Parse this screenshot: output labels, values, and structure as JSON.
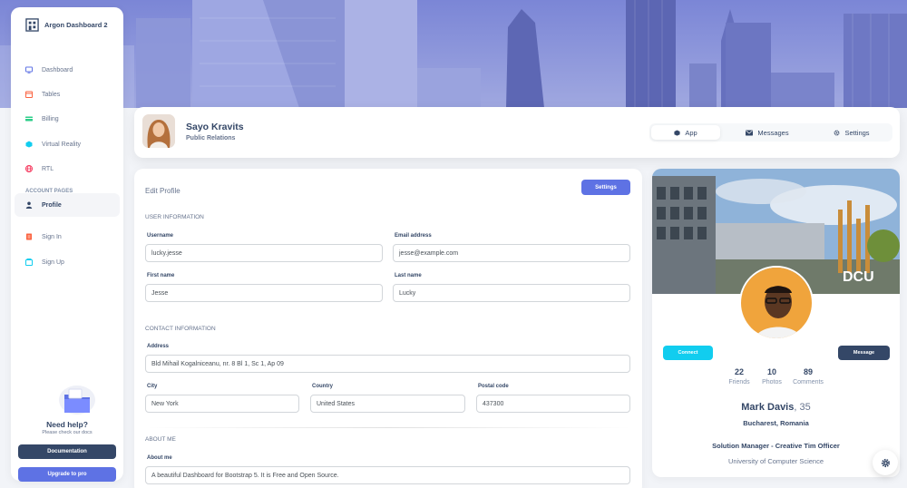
{
  "brand": {
    "name": "Argon Dashboard 2",
    "logo_icon": "buildings-logo-icon"
  },
  "sidebar": {
    "items": [
      {
        "label": "Dashboard",
        "icon": "tv-icon",
        "color": "#5e72e4"
      },
      {
        "label": "Tables",
        "icon": "calendar-icon",
        "color": "#fb6340"
      },
      {
        "label": "Billing",
        "icon": "credit-card-icon",
        "color": "#2dce89"
      },
      {
        "label": "Virtual Reality",
        "icon": "app-icon",
        "color": "#11cdef"
      },
      {
        "label": "RTL",
        "icon": "world-icon",
        "color": "#f5365c"
      }
    ],
    "section_label": "ACCOUNT PAGES",
    "account_items": [
      {
        "label": "Profile",
        "icon": "user-icon",
        "color": "#344767",
        "active": true
      },
      {
        "label": "Sign In",
        "icon": "document-icon",
        "color": "#fb6340"
      },
      {
        "label": "Sign Up",
        "icon": "collection-icon",
        "color": "#11cdef"
      }
    ],
    "help_title": "Need help?",
    "help_subtitle": "Please check our docs",
    "documentation_label": "Documentation",
    "upgrade_label": "Upgrade to pro"
  },
  "profile": {
    "name": "Sayo Kravits",
    "role": "Public Relations",
    "tabs": [
      {
        "label": "App",
        "icon": "cube-icon",
        "active": true
      },
      {
        "label": "Messages",
        "icon": "envelope-icon"
      },
      {
        "label": "Settings",
        "icon": "gear-icon"
      }
    ]
  },
  "edit": {
    "title": "Edit Profile",
    "settings_label": "Settings",
    "user_info_title": "USER INFORMATION",
    "username_label": "Username",
    "username_value": "lucky.jesse",
    "email_label": "Email address",
    "email_value": "jesse@example.com",
    "first_name_label": "First name",
    "first_name_value": "Jesse",
    "last_name_label": "Last name",
    "last_name_value": "Lucky",
    "contact_title": "CONTACT INFORMATION",
    "address_label": "Address",
    "address_value": "Bld Mihail Kogalniceanu, nr. 8 Bl 1, Sc 1, Ap 09",
    "city_label": "City",
    "city_value": "New York",
    "country_label": "Country",
    "country_value": "United States",
    "postal_label": "Postal code",
    "postal_value": "437300",
    "about_title": "ABOUT ME",
    "about_label": "About me",
    "about_value": "A beautiful Dashboard for Bootstrap 5. It is Free and Open Source."
  },
  "card": {
    "connect_label": "Connect",
    "message_label": "Message",
    "stats": [
      {
        "value": "22",
        "label": "Friends"
      },
      {
        "value": "10",
        "label": "Photos"
      },
      {
        "value": "89",
        "label": "Comments"
      }
    ],
    "name": "Mark Davis",
    "age": ", 35",
    "location": "Bucharest, Romania",
    "job": "Solution Manager - Creative Tim Officer",
    "university": "University of Computer Science",
    "cover_sign": "DCU"
  },
  "colors": {
    "primary": "#5e72e4",
    "dark": "#344767",
    "info": "#11cdef"
  }
}
